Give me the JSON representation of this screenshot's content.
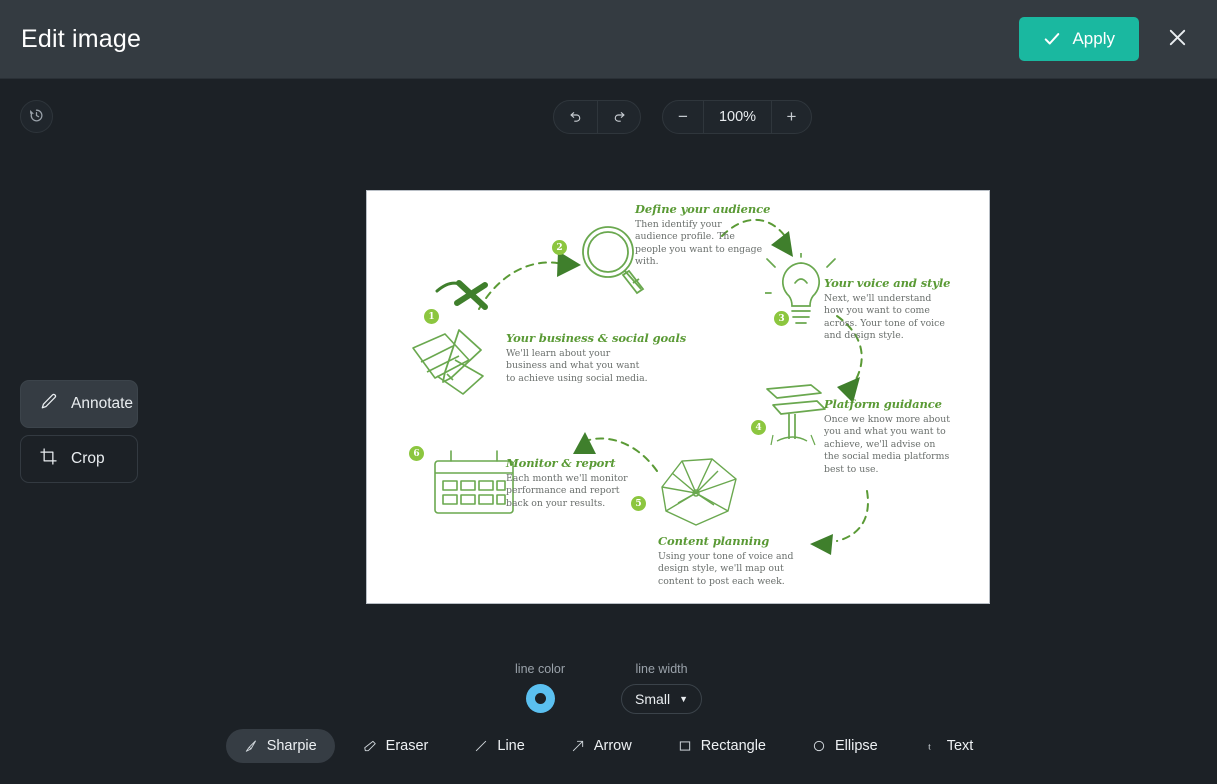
{
  "header": {
    "title": "Edit image",
    "apply_label": "Apply",
    "apply_color": "#1ab8a0",
    "check_icon": "check-icon",
    "close_icon": "close-icon"
  },
  "toolbar": {
    "history_icon": "history-restore-icon",
    "undo_icon": "undo-icon",
    "redo_icon": "redo-icon",
    "zoom_out_label": "−",
    "zoom_level": "100%",
    "zoom_in_label": "+"
  },
  "left_panel": {
    "items": [
      {
        "label": "Annotate",
        "icon": "pencil-icon",
        "active": true
      },
      {
        "label": "Crop",
        "icon": "crop-icon",
        "active": false
      }
    ]
  },
  "options": {
    "line_color_label": "line color",
    "line_color_value": "#5bc0f0",
    "line_width_label": "line width",
    "line_width_value": "Small",
    "caret": "▼"
  },
  "tools": [
    {
      "label": "Sharpie",
      "icon": "sharpie-icon",
      "active": true
    },
    {
      "label": "Eraser",
      "icon": "eraser-icon",
      "active": false
    },
    {
      "label": "Line",
      "icon": "line-icon",
      "active": false
    },
    {
      "label": "Arrow",
      "icon": "arrow-icon",
      "active": false
    },
    {
      "label": "Rectangle",
      "icon": "rectangle-icon",
      "active": false
    },
    {
      "label": "Ellipse",
      "icon": "ellipse-icon",
      "active": false
    },
    {
      "label": "Text",
      "icon": "text-icon",
      "active": false
    }
  ],
  "image": {
    "alt": "social media process infographic",
    "accent_color": "#5a9a35",
    "badge_color": "#8cc63f",
    "steps": [
      {
        "number": "1",
        "title": "Your business & social goals",
        "body": "We'll learn about your business and what you want to achieve using social media.",
        "art": "pen-and-notebook-illustration"
      },
      {
        "number": "2",
        "title": "Define your audience",
        "body": "Then identify your audience profile. The people you want to engage with.",
        "art": "magnifying-glass-illustration"
      },
      {
        "number": "3",
        "title": "Your voice and style",
        "body": "Next, we'll understand how you want to come across. Your tone of voice and design style.",
        "art": "lightbulb-illustration"
      },
      {
        "number": "4",
        "title": "Platform guidance",
        "body": "Once we know more about you and what you want to achieve, we'll advise on the social media platforms best to use.",
        "art": "signpost-illustration"
      },
      {
        "number": "5",
        "title": "Content planning",
        "body": "Using your tone of voice and design style, we'll map out content to post each week.",
        "art": "network-map-illustration"
      },
      {
        "number": "6",
        "title": "Monitor & report",
        "body": "Each month we'll monitor performance and report back on your results.",
        "art": "calendar-illustration"
      }
    ]
  }
}
